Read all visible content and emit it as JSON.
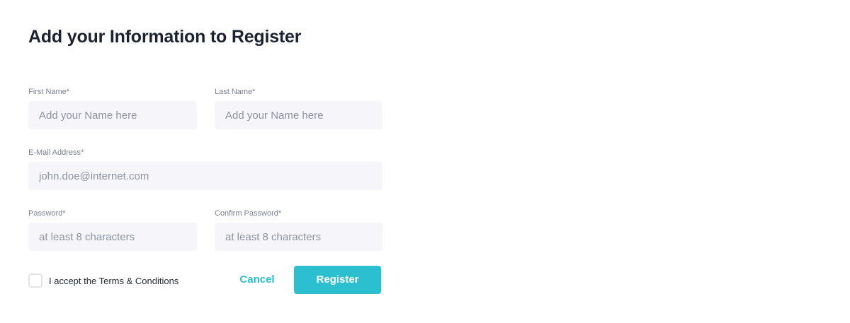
{
  "form": {
    "title": "Add your Information to Register",
    "first_name": {
      "label": "First Name*",
      "value": "",
      "placeholder": "Add your Name here"
    },
    "last_name": {
      "label": "Last Name*",
      "value": "",
      "placeholder": "Add your Name here"
    },
    "email": {
      "label": "E-Mail Address*",
      "value": "",
      "placeholder": "john.doe@internet.com"
    },
    "password": {
      "label": "Password*",
      "value": "",
      "placeholder": "at least 8 characters"
    },
    "confirm_password": {
      "label": "Confirm Password*",
      "value": "",
      "placeholder": "at least 8 characters"
    },
    "terms": {
      "label": "I accept the Terms & Conditions",
      "checked": false
    },
    "cancel_label": "Cancel",
    "register_label": "Register"
  },
  "colors": {
    "accent": "#2bbfd0",
    "input_background": "#f6f6fa",
    "title_text": "#1d2230",
    "label_text": "#7d8190"
  }
}
